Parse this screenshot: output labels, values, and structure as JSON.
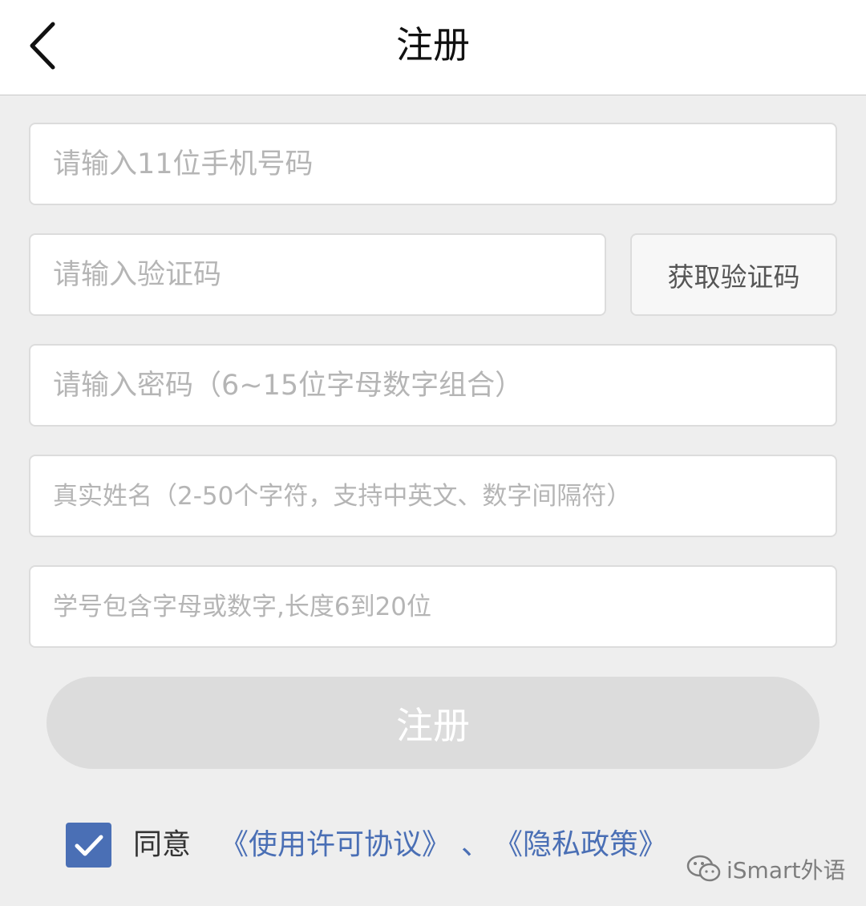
{
  "header": {
    "title": "注册"
  },
  "form": {
    "phone_placeholder": "请输入11位手机号码",
    "code_placeholder": "请输入验证码",
    "get_code_label": "获取验证码",
    "password_placeholder": "请输入密码（6~15位字母数字组合）",
    "name_placeholder": "真实姓名（2-50个字符，支持中英文、数字间隔符）",
    "student_id_placeholder": "学号包含字母或数字,长度6到20位",
    "submit_label": "注册"
  },
  "agreement": {
    "checked": true,
    "agree_label": "同意",
    "terms_link": "《使用许可协议》",
    "separator": "、",
    "privacy_link": "《隐私政策》"
  },
  "watermark": {
    "text": "iSmart外语",
    "icon": "wechat-icon"
  },
  "colors": {
    "background": "#eeeeee",
    "accent": "#4a6fb5",
    "disabled_button": "#dcdcdc"
  }
}
